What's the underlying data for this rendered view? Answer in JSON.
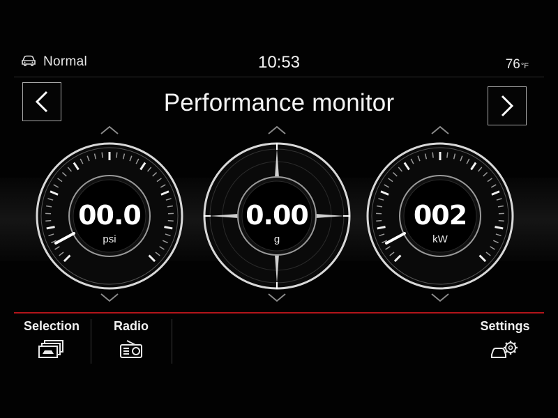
{
  "status": {
    "drive_mode": "Normal",
    "drive_icon": "car-icon",
    "time": "10:53",
    "temperature": "76",
    "temperature_unit": "°F"
  },
  "title": {
    "text": "Performance monitor",
    "prev_icon": "chevron-left-icon",
    "next_icon": "chevron-right-icon"
  },
  "gauges": [
    {
      "id": "boost",
      "value": "00.0",
      "unit": "psi",
      "needle_icon": "needle"
    },
    {
      "id": "g-force",
      "value": "0.00",
      "unit": "g",
      "needle_icon": "crosshair"
    },
    {
      "id": "power",
      "value": "002",
      "unit": "kW",
      "needle_icon": "needle"
    }
  ],
  "bottom_bar": {
    "selection": {
      "label": "Selection",
      "icon": "stacked-cards-icon"
    },
    "radio": {
      "label": "Radio",
      "icon": "radio-icon"
    },
    "settings": {
      "label": "Settings",
      "icon": "car-gear-icon"
    }
  },
  "colors": {
    "accent_red": "#b2141a",
    "background": "#020202",
    "text": "#ffffff"
  }
}
